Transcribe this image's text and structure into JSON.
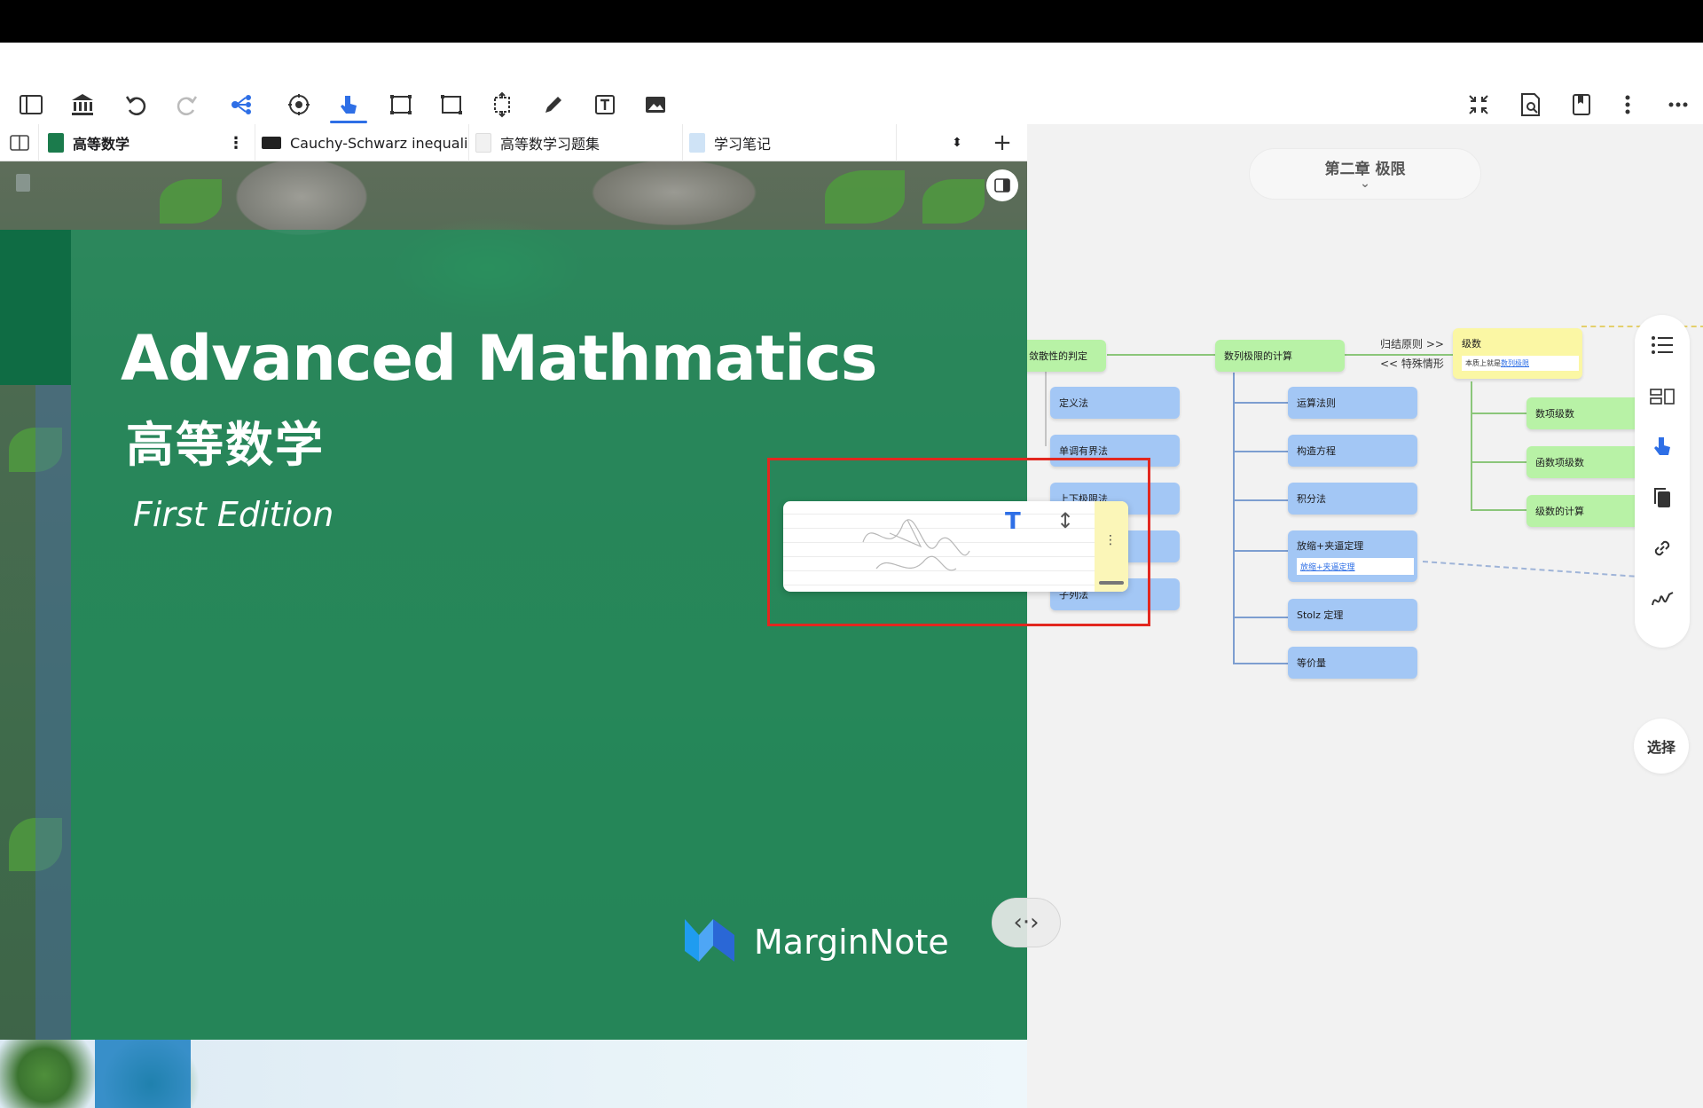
{
  "toolbar": {
    "left_icons": [
      "sidebar-icon",
      "library-icon",
      "undo-icon",
      "redo-icon",
      "mindmap-share-icon",
      "settings-cycle-icon",
      "hand-pointer-icon",
      "select-rect-icon",
      "crop-icon",
      "expand-icon",
      "pen-icon",
      "text-box-icon",
      "image-icon"
    ],
    "right_icons": [
      "collapse-icon",
      "search-doc-icon",
      "bookmark-icon",
      "more-vertical-icon",
      "more-horizontal-icon"
    ],
    "accent": "#2e6fe6"
  },
  "tabs": [
    {
      "label": "高等数学",
      "active": true
    },
    {
      "label": "Cauchy-Schwarz inequali...",
      "active": false
    },
    {
      "label": "高等数学习题集",
      "active": false
    },
    {
      "label": "学习笔记",
      "active": false
    }
  ],
  "document": {
    "title_en": "Advanced Mathmatics",
    "title_cn": "高等数学",
    "edition": "First Edition",
    "publisher": "MarginNote",
    "cover_color": "#1c925e"
  },
  "mindmap": {
    "chapter": "第二章 极限",
    "nodes": {
      "convergence": "敛散性的判定",
      "definition": "定义法",
      "monotone": "单调有界法",
      "limsup": "上下极限法",
      "subseq": "子列法",
      "seq_calc": "数列极限的计算",
      "rules": "运算法则",
      "equation": "构造方程",
      "integral": "积分法",
      "squeeze": "放缩+夹逼定理",
      "squeeze_link": "放缩+夹逼定理",
      "stolz": "Stolz 定理",
      "equiv": "等价量",
      "series": "级数",
      "series_note": "本质上就是",
      "series_note_link": "数列极限",
      "num_series": "数项级数",
      "func_series": "函数项级数",
      "series_calc": "级数的计算"
    },
    "relations": {
      "reduction": "归结原则 >>",
      "special": "<< 特殊情形"
    },
    "select_label": "选择"
  }
}
